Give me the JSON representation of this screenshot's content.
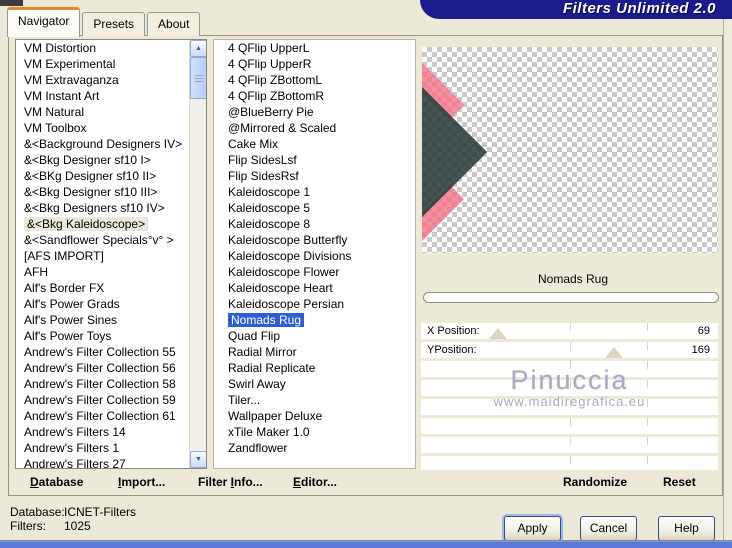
{
  "title_bar": {
    "title": "Filters Unlimited 2.0"
  },
  "tabs": {
    "active_index": 0,
    "items": [
      {
        "label": "Navigator"
      },
      {
        "label": "Presets"
      },
      {
        "label": "About"
      }
    ]
  },
  "category_list": {
    "selected_index": 11,
    "items": [
      "VM Distortion",
      "VM Experimental",
      "VM Extravaganza",
      "VM Instant Art",
      "VM Natural",
      "VM Toolbox",
      "&<Background Designers IV>",
      "&<Bkg Designer sf10 I>",
      "&<BKg Designer sf10 II>",
      "&<Bkg Designer sf10 III>",
      "&<Bkg Designers sf10 IV>",
      "&<Bkg Kaleidoscope>",
      "&<Sandflower Specials°v° >",
      "[AFS IMPORT]",
      "AFH",
      "Alf's Border FX",
      "Alf's Power Grads",
      "Alf's Power Sines",
      "Alf's Power Toys",
      "Andrew's Filter Collection 55",
      "Andrew's Filter Collection 56",
      "Andrew's Filter Collection 58",
      "Andrew's Filter Collection 59",
      "Andrew's Filter Collection 61",
      "Andrew's Filters 14",
      "Andrew's Filters 1",
      "Andrew's Filters 27"
    ]
  },
  "filter_list": {
    "selected_index": 17,
    "items": [
      "4 QFlip UpperL",
      "4 QFlip UpperR",
      "4 QFlip ZBottomL",
      "4 QFlip ZBottomR",
      "@BlueBerry Pie",
      "@Mirrored & Scaled",
      "Cake Mix",
      "Flip SidesLsf",
      "Flip SidesRsf",
      "Kaleidoscope 1",
      "Kaleidoscope 5",
      "Kaleidoscope 8",
      "Kaleidoscope Butterfly",
      "Kaleidoscope Divisions",
      "Kaleidoscope Flower",
      "Kaleidoscope Heart",
      "Kaleidoscope Persian",
      "Nomads Rug",
      "Quad Flip",
      "Radial Mirror",
      "Radial Replicate",
      "Swirl Away",
      "Tiler...",
      "Wallpaper Deluxe",
      "xTile Maker 1.0",
      "Zandflower"
    ]
  },
  "preview": {
    "selected_filter_label": "Nomads Rug",
    "empty_rows": 6,
    "watermark": {
      "line1": "Pinuccia",
      "line2": "www.maidiregrafica.eu"
    }
  },
  "sliders": [
    {
      "label": "X Position:",
      "value": "69",
      "thumb_percent": 26
    },
    {
      "label": "YPosition:",
      "value": "169",
      "thumb_percent": 65
    }
  ],
  "bottom_menu": {
    "items": [
      {
        "pre": "",
        "underlined": "D",
        "rest": "atabase"
      },
      {
        "pre": "",
        "underlined": "I",
        "rest": "mport..."
      },
      {
        "pre": "Filter ",
        "underlined": "I",
        "rest": "nfo..."
      },
      {
        "pre": "",
        "underlined": "E",
        "rest": "ditor..."
      }
    ]
  },
  "panel_buttons": {
    "randomize": "Randomize",
    "reset": "Reset"
  },
  "status": {
    "database_label": "Database:",
    "database_value": "ICNET-Filters",
    "filters_label": "Filters:",
    "filters_value": "1025"
  },
  "dialog_buttons": {
    "apply": "Apply",
    "cancel": "Cancel",
    "help": "Help"
  },
  "colors": {
    "banner": "#1b1b8e",
    "selection": "#2e5ed2",
    "inactive_selection": "#ebe8da",
    "preview_dark_rgba": "rgba(43,58,58,0.87)",
    "preview_pink_rgba": "rgba(244,116,134,0.8)",
    "watermark": "#aba8c6"
  }
}
